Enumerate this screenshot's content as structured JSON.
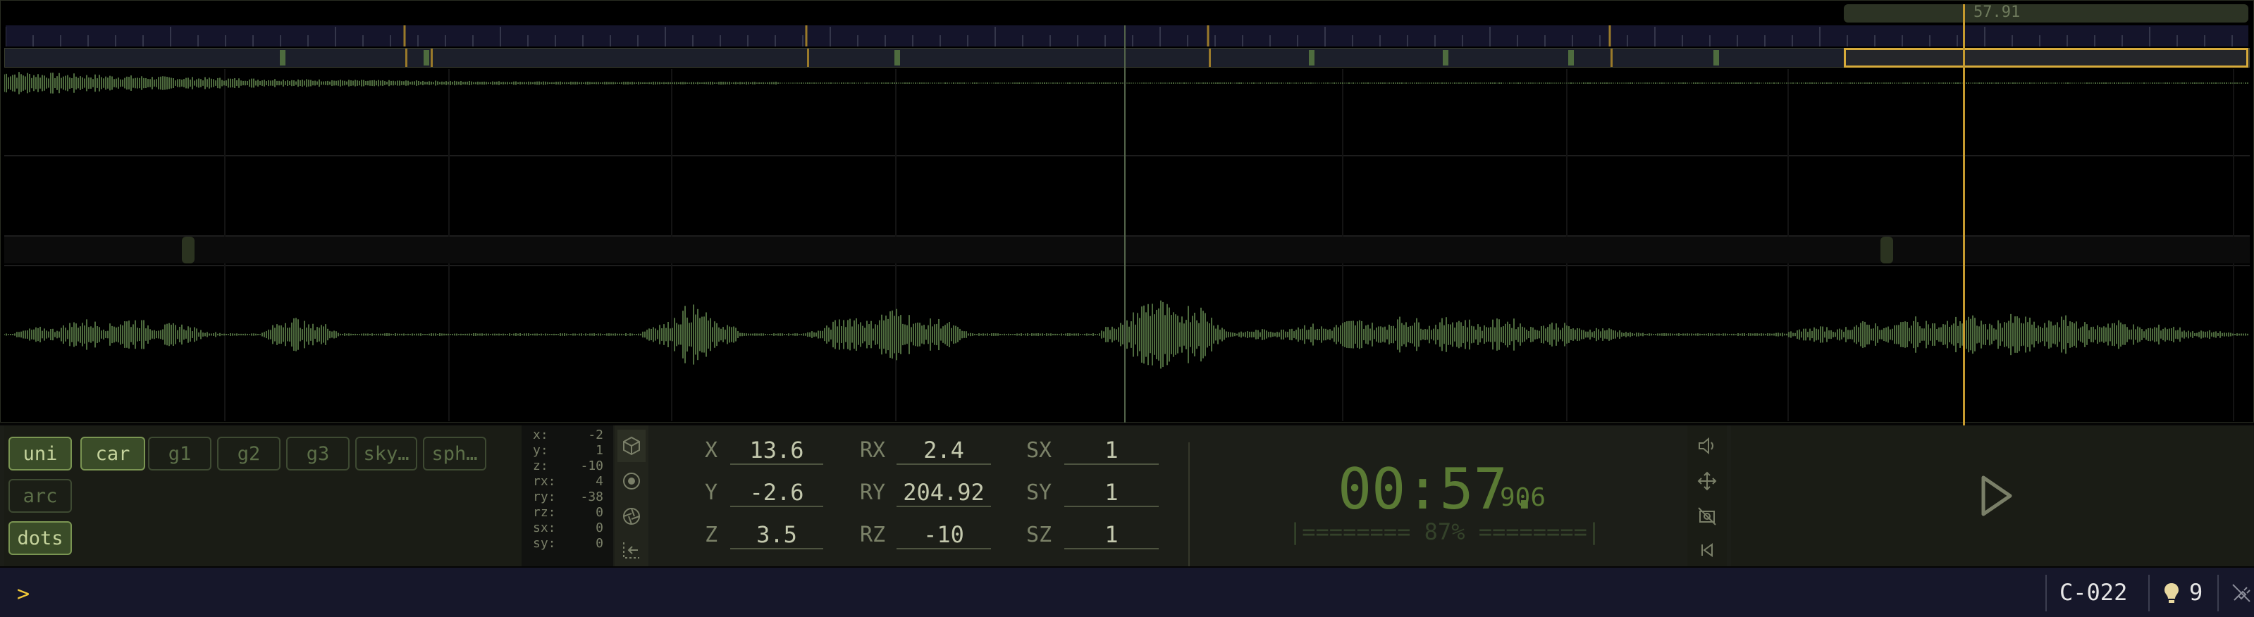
{
  "timeline": {
    "playhead_time_label": "57.91"
  },
  "groups": [
    {
      "label": "uni",
      "active": true
    },
    {
      "label": "car",
      "active": true
    },
    {
      "label": "g1",
      "active": false
    },
    {
      "label": "g2",
      "active": false
    },
    {
      "label": "g3",
      "active": false
    },
    {
      "label": "sky…",
      "active": false
    },
    {
      "label": "sph…",
      "active": false
    },
    {
      "label": "arc",
      "active": false
    },
    {
      "label": "dots",
      "active": true
    }
  ],
  "readout": [
    {
      "k": "x:",
      "v": "-2"
    },
    {
      "k": "y:",
      "v": "1"
    },
    {
      "k": "z:",
      "v": "-10"
    },
    {
      "k": "rx:",
      "v": "4"
    },
    {
      "k": "ry:",
      "v": "-38"
    },
    {
      "k": "rz:",
      "v": "0"
    },
    {
      "k": "sx:",
      "v": "0"
    },
    {
      "k": "sy:",
      "v": "0"
    }
  ],
  "transform": {
    "x_label": "X",
    "x": "13.6",
    "y_label": "Y",
    "y": "-2.6",
    "z_label": "Z",
    "z": "3.5",
    "rx_label": "RX",
    "rx": "2.4",
    "ry_label": "RY",
    "ry": "204.92",
    "rz_label": "RZ",
    "rz": "-10",
    "sx_label": "SX",
    "sx": "1",
    "sy_label": "SY",
    "sy": "1",
    "sz_label": "SZ",
    "sz": "1"
  },
  "clock": {
    "time": "00:57.",
    "ms": "906",
    "progress_text": "|======== 87% ========|",
    "progress": 0.87
  },
  "icons": {
    "left_col": [
      "cube-icon",
      "target-icon",
      "aperture-icon",
      "exit-icon"
    ],
    "right_col": [
      "speaker-icon",
      "move-icon",
      "no-camera-icon",
      "skip-back-icon"
    ],
    "play": "play-icon"
  },
  "statusbar": {
    "prompt": ">",
    "code": "C-022",
    "count": "9"
  },
  "colors": {
    "accent": "#d7ab3a",
    "waveform": "#4e6b3e",
    "active_button": "#3a4c28",
    "clock": "#5a7a34",
    "prompt": "#f0c838"
  }
}
